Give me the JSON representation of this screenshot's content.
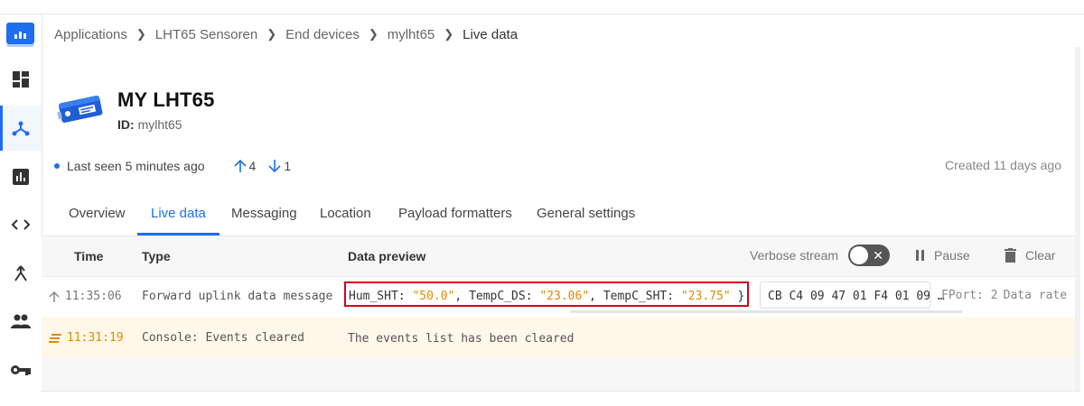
{
  "breadcrumb": [
    "Applications",
    "LHT65 Sensoren",
    "End devices",
    "mylht65",
    "Live data"
  ],
  "device": {
    "title": "MY LHT65",
    "id_label": "ID:",
    "id_value": "mylht65"
  },
  "status": {
    "last_seen": "Last seen 5 minutes ago",
    "uplink_count": "4",
    "downlink_count": "1",
    "created": "Created 11 days ago"
  },
  "tabs": [
    "Overview",
    "Live data",
    "Messaging",
    "Location",
    "Payload formatters",
    "General settings"
  ],
  "active_tab": "Live data",
  "table": {
    "headers": {
      "time": "Time",
      "type": "Type",
      "preview": "Data preview"
    },
    "verbose_label": "Verbose stream",
    "verbose_on": false,
    "pause_label": "Pause",
    "clear_label": "Clear"
  },
  "events": [
    {
      "time": "11:35:06",
      "type": "Forward uplink data message",
      "payload": [
        {
          "key": "Hum_SHT",
          "value": "\"50.0\""
        },
        {
          "key": "TempC_DS",
          "value": "\"23.06\""
        },
        {
          "key": "TempC_SHT",
          "value": "\"23.75\""
        }
      ],
      "payload_tail": "}",
      "raw": "CB C4 09 47 01 F4 01 09 …",
      "fport": "FPort: 2",
      "datarate": "Data rate"
    },
    {
      "time": "11:31:19",
      "type": "Console: Events cleared",
      "message": "The events list has been cleared"
    }
  ],
  "colors": {
    "accent": "#1e6ef0",
    "highlight_box": "#d0021b",
    "value_orange": "#e08a00",
    "console_row_bg": "#fff8ea"
  },
  "icons": {
    "sidebar": [
      "overview-icon",
      "applications-icon",
      "gateways-icon",
      "code-icon",
      "organizations-icon",
      "users-icon",
      "api-keys-icon"
    ]
  }
}
